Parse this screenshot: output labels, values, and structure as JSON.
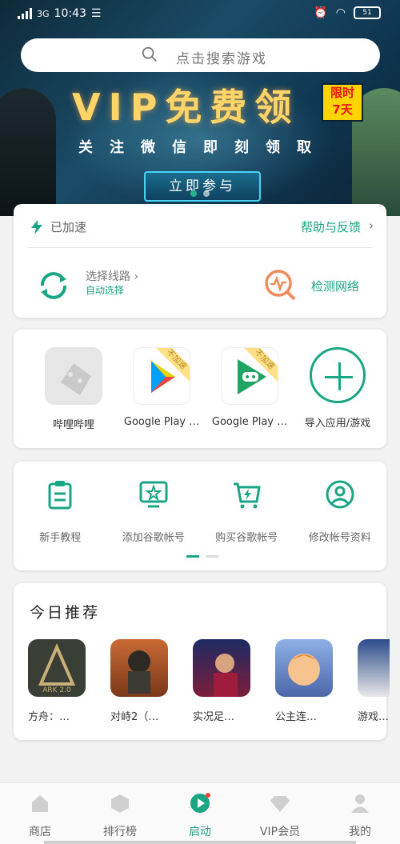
{
  "status_bar": {
    "network": "3G",
    "time": "10:43",
    "battery": "51"
  },
  "search": {
    "placeholder": "点击搜索游戏"
  },
  "banner": {
    "title": "VIP免费领",
    "badge_line1": "限时",
    "badge_line2": "7天",
    "subtitle": "关注微信即刻领取",
    "button": "立即参与"
  },
  "accel_card": {
    "status": "已加速",
    "help": "帮助与反馈",
    "route_title": "选择线路",
    "route_sub": "自动选择",
    "net_check": "检测网络"
  },
  "apps": [
    {
      "name": "哔哩哔哩",
      "ribbon": ""
    },
    {
      "name": "Google Play …",
      "ribbon": "不加速"
    },
    {
      "name": "Google Play …",
      "ribbon": "不加速"
    },
    {
      "name": "导入应用/游戏",
      "ribbon": ""
    }
  ],
  "tools": [
    {
      "name": "新手教程",
      "icon": "clipboard-icon"
    },
    {
      "name": "添加谷歌帐号",
      "icon": "monitor-star-icon"
    },
    {
      "name": "购买谷歌帐号",
      "icon": "cart-bolt-icon"
    },
    {
      "name": "修改帐号资料",
      "icon": "user-circle-icon"
    }
  ],
  "recommend": {
    "title": "今日推荐",
    "games": [
      {
        "name": "方舟：…",
        "color": "#3a3f36"
      },
      {
        "name": "对峙2（…",
        "color": "#b5562a"
      },
      {
        "name": "实况足…",
        "color": "#1d2b64"
      },
      {
        "name": "公主连…",
        "color": "#6b88c9"
      },
      {
        "name": "游戏…",
        "color": "#e8e8e8"
      }
    ]
  },
  "nav": [
    {
      "label": "商店",
      "icon": "store-icon"
    },
    {
      "label": "排行榜",
      "icon": "ranking-icon"
    },
    {
      "label": "启动",
      "icon": "launch-icon"
    },
    {
      "label": "VIP会员",
      "icon": "diamond-icon"
    },
    {
      "label": "我的",
      "icon": "profile-icon"
    }
  ],
  "colors": {
    "accent": "#1aa584",
    "orange": "#f08a5a",
    "banner_gold": "#ffd56a"
  }
}
